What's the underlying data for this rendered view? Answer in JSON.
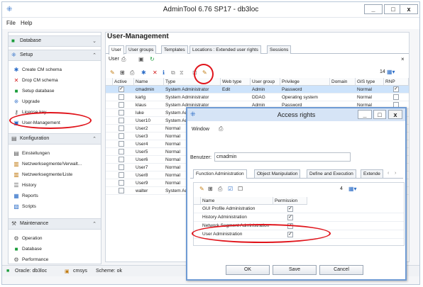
{
  "app": {
    "title": "AdminTool 6.76 SP17 - db3loc",
    "icon": "app-logo-icon",
    "min": "_",
    "max": "□",
    "close": "x"
  },
  "menu": [
    "File",
    "Help"
  ],
  "sidebar": {
    "database_section": "Database",
    "setup_section": "Setup",
    "setup_items": [
      {
        "label": "Create CM schema",
        "icon": "sparkle-icon"
      },
      {
        "label": "Drop CM schema",
        "icon": "red-x-icon"
      },
      {
        "label": "Setup database",
        "icon": "database-icon"
      },
      {
        "label": "Upgrade",
        "icon": "upgrade-icon"
      },
      {
        "label": "License key",
        "icon": "key-icon"
      },
      {
        "label": "User-Management",
        "icon": "user-management-icon"
      }
    ],
    "config_section": "Konfiguration",
    "config_items": [
      {
        "label": "Einstellungen",
        "icon": "settings-icon"
      },
      {
        "label": "Netzwerksegmente/Verwalt...",
        "icon": "network-icon"
      },
      {
        "label": "Netzwerksegmente/Liste",
        "icon": "network-list-icon"
      },
      {
        "label": "History",
        "icon": "history-icon"
      },
      {
        "label": "Reports",
        "icon": "reports-icon"
      },
      {
        "label": "Scripts",
        "icon": "scripts-icon"
      }
    ],
    "maint_section": "Maintenance",
    "maint_items": [
      {
        "label": "Operation",
        "icon": "operation-icon"
      },
      {
        "label": "Database",
        "icon": "database-icon"
      },
      {
        "label": "Performance",
        "icon": "performance-icon"
      }
    ]
  },
  "main": {
    "header": "User-Management",
    "tabs": [
      "User",
      "User groups",
      "Templates",
      "Locations : Extended user rights",
      "Sessions"
    ],
    "toolbar_label": "User",
    "close": "×",
    "count": "14",
    "columns": [
      "Active",
      "Name",
      "Type",
      "Web type",
      "User group",
      "Privilege",
      "Domain",
      "GIS type",
      "RNP"
    ],
    "rows": [
      {
        "name": "cmadmin",
        "type": "System Administrator",
        "web": "Edit",
        "group": "Admin",
        "priv": "Password",
        "gis": "Normal",
        "active": true,
        "rnp": true
      },
      {
        "name": "karlg",
        "type": "System Administrator",
        "web": "",
        "group": "DDAG",
        "priv": "Operating system",
        "gis": "Normal",
        "active": false,
        "rnp": false
      },
      {
        "name": "klaus",
        "type": "System Administrator",
        "web": "",
        "group": "Admin",
        "priv": "Password",
        "gis": "Normal",
        "active": false,
        "rnp": false
      },
      {
        "name": "luke",
        "type": "System Ad",
        "web": "",
        "group": "",
        "priv": "",
        "gis": "",
        "active": false,
        "rnp": false
      },
      {
        "name": "User10",
        "type": "System Ad",
        "web": "",
        "group": "",
        "priv": "",
        "gis": "",
        "active": false,
        "rnp": false
      },
      {
        "name": "User2",
        "type": "Normal",
        "web": "",
        "group": "",
        "priv": "",
        "gis": "",
        "active": false,
        "rnp": false
      },
      {
        "name": "User3",
        "type": "Normal",
        "web": "",
        "group": "",
        "priv": "",
        "gis": "",
        "active": false,
        "rnp": false
      },
      {
        "name": "User4",
        "type": "Normal",
        "web": "",
        "group": "",
        "priv": "",
        "gis": "",
        "active": false,
        "rnp": false
      },
      {
        "name": "User5",
        "type": "Normal",
        "web": "",
        "group": "",
        "priv": "",
        "gis": "",
        "active": false,
        "rnp": false
      },
      {
        "name": "User6",
        "type": "Normal",
        "web": "",
        "group": "",
        "priv": "",
        "gis": "",
        "active": false,
        "rnp": false
      },
      {
        "name": "User7",
        "type": "Normal",
        "web": "",
        "group": "",
        "priv": "",
        "gis": "",
        "active": false,
        "rnp": false
      },
      {
        "name": "User8",
        "type": "Normal",
        "web": "",
        "group": "",
        "priv": "",
        "gis": "",
        "active": false,
        "rnp": false
      },
      {
        "name": "User9",
        "type": "Normal",
        "web": "",
        "group": "",
        "priv": "",
        "gis": "",
        "active": false,
        "rnp": false
      },
      {
        "name": "walter",
        "type": "System Ad",
        "web": "",
        "group": "",
        "priv": "",
        "gis": "",
        "active": false,
        "rnp": false
      }
    ]
  },
  "status": {
    "oracle": "Oracle: db3loc",
    "user": "cmsys",
    "scheme": "Scheme: ok"
  },
  "dialog": {
    "title": "Access rights",
    "window_label": "Window",
    "user_label": "Benutzer:",
    "user_value": "cmadmin",
    "tabs": [
      "Function Administration",
      "Object Manipulation",
      "Define and Execution",
      "Extende"
    ],
    "count": "4",
    "columns": [
      "Name",
      "Permission"
    ],
    "rows": [
      {
        "name": "GUI Profile Administration",
        "perm": true
      },
      {
        "name": "History Administration",
        "perm": true
      },
      {
        "name": "Network Segment Administration",
        "perm": true
      },
      {
        "name": "User Administration",
        "perm": true
      }
    ],
    "ok": "OK",
    "save": "Save",
    "cancel": "Cancel"
  },
  "colors": {
    "highlight": "#e0141b",
    "accent": "#2a6cc7",
    "selected_row": "#cde3fb"
  }
}
